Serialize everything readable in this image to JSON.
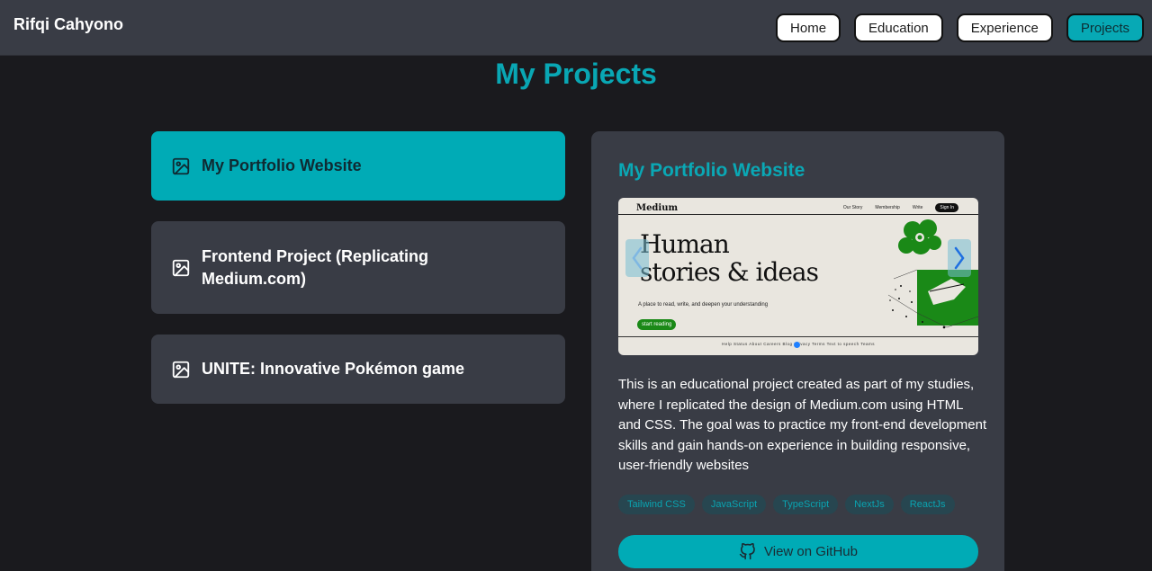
{
  "header": {
    "brand": "Rifqi Cahyono",
    "nav": [
      "Home",
      "Education",
      "Experience",
      "Projects"
    ],
    "active_nav": "Projects"
  },
  "page": {
    "title": "My Projects"
  },
  "projects": [
    {
      "title": "My Portfolio Website",
      "active": true,
      "icon": "image-icon"
    },
    {
      "title": "Frontend Project (Replicating Medium.com)",
      "active": false,
      "icon": "image-icon"
    },
    {
      "title": "UNITE: Innovative Pokémon game",
      "active": false,
      "icon": "image-icon"
    }
  ],
  "detail": {
    "title": "My Portfolio Website",
    "screenshot": {
      "logo": "Medium",
      "nav": [
        "Our Story",
        "Membership",
        "Write",
        "Sign In"
      ],
      "hero_line1": "Human",
      "hero_line2": "stories & ideas",
      "subtitle": "A place to read, write, and deepen your understanding",
      "cta": "start reading",
      "footer": "Help  Status  About  Careers  Blog  Privacy  Terms  Text to speech  Teams"
    },
    "description": "This is an educational project created as part of my studies, where I replicated the design of Medium.com using HTML and CSS. The goal was to practice my front-end development skills and gain hands-on experience in building responsive, user-friendly websites",
    "tags": [
      "Tailwind CSS",
      "JavaScript",
      "TypeScript",
      "NextJs",
      "ReactJs"
    ],
    "github_label": "View on GitHub"
  },
  "colors": {
    "accent": "#00abb6",
    "panel": "#393c45",
    "background": "#1a1a1e"
  }
}
